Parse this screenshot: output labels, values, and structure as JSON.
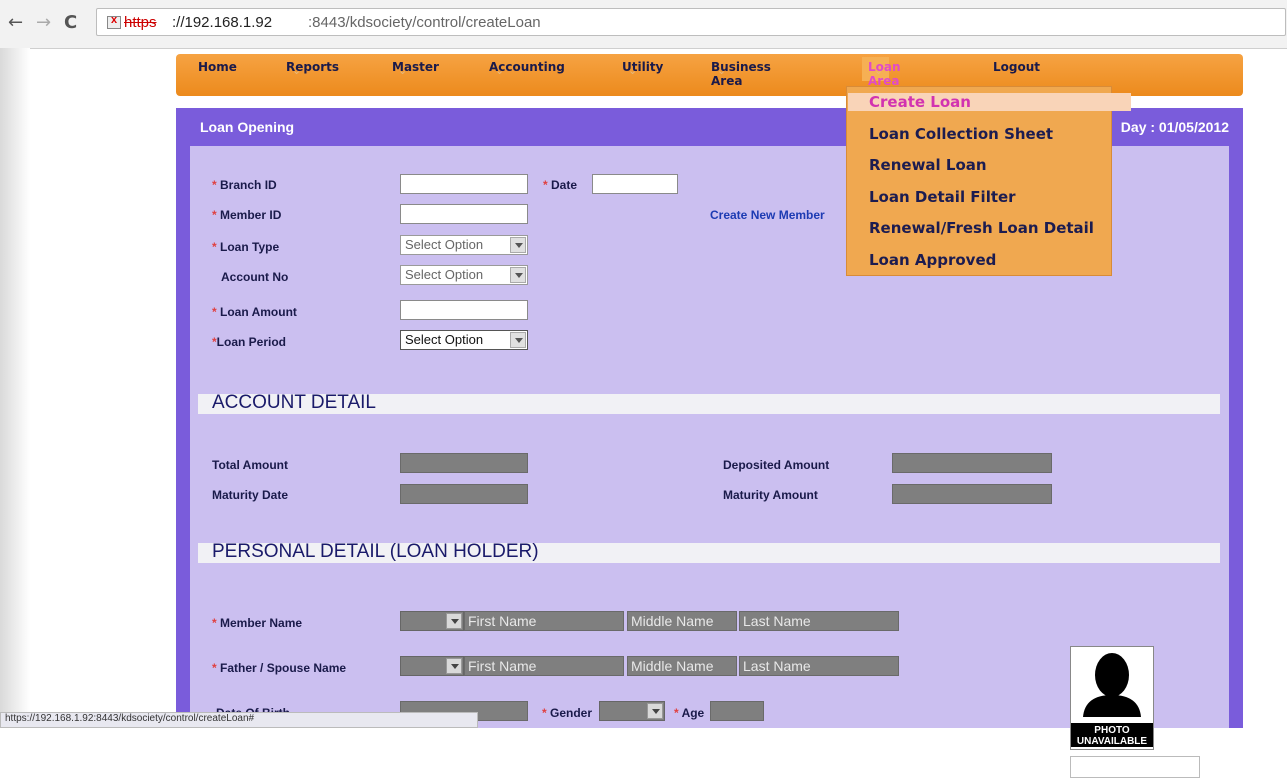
{
  "browser": {
    "back": "←",
    "forward": "→",
    "reload": "C",
    "url_protocol": "https",
    "url_host": "://192.168.1.92",
    "url_path": ":8443/kdsociety/control/createLoan"
  },
  "menu": {
    "items": [
      {
        "label": "Home"
      },
      {
        "label": "Reports"
      },
      {
        "label": "Master"
      },
      {
        "label": "Accounting"
      },
      {
        "label": "Utility"
      },
      {
        "label": "Business Area"
      },
      {
        "label": "Loan Area"
      },
      {
        "label": "Logout"
      }
    ],
    "chevron": "⌄"
  },
  "dropdown": {
    "items": [
      "Create Loan",
      "Loan Collection Sheet",
      "Renewal Loan",
      "Loan Detail Filter",
      "Renewal/Fresh Loan Detail",
      "Loan Approved"
    ]
  },
  "panel": {
    "title": "Loan Opening",
    "day": "Day : 01/05/2012"
  },
  "form": {
    "branch_id": "Branch ID",
    "date": "Date",
    "member_id": "Member ID",
    "create_member": "Create New Member",
    "loan_type": "Loan Type",
    "account_no": "Account No",
    "loan_amount": "Loan Amount",
    "loan_period": "Loan Period",
    "select_option": "Select Option",
    "required_mark": "*"
  },
  "account": {
    "heading": "ACCOUNT DETAIL",
    "total_amount": "Total Amount",
    "maturity_date": "Maturity Date",
    "deposited_amount": "Deposited Amount",
    "maturity_amount": "Maturity Amount"
  },
  "personal": {
    "heading": "PERSONAL DETAIL (LOAN HOLDER)",
    "member_name": "Member Name",
    "father_spouse": "Father / Spouse Name",
    "dob": "Date Of Birth",
    "gender": "Gender",
    "age": "Age",
    "first_name": "First Name",
    "middle_name": "Middle Name",
    "last_name": "Last Name",
    "photo_text_1": "PHOTO",
    "photo_text_2": "UNAVAILABLE"
  },
  "status_bar": "https://192.168.1.92:8443/kdsociety/control/createLoan#"
}
